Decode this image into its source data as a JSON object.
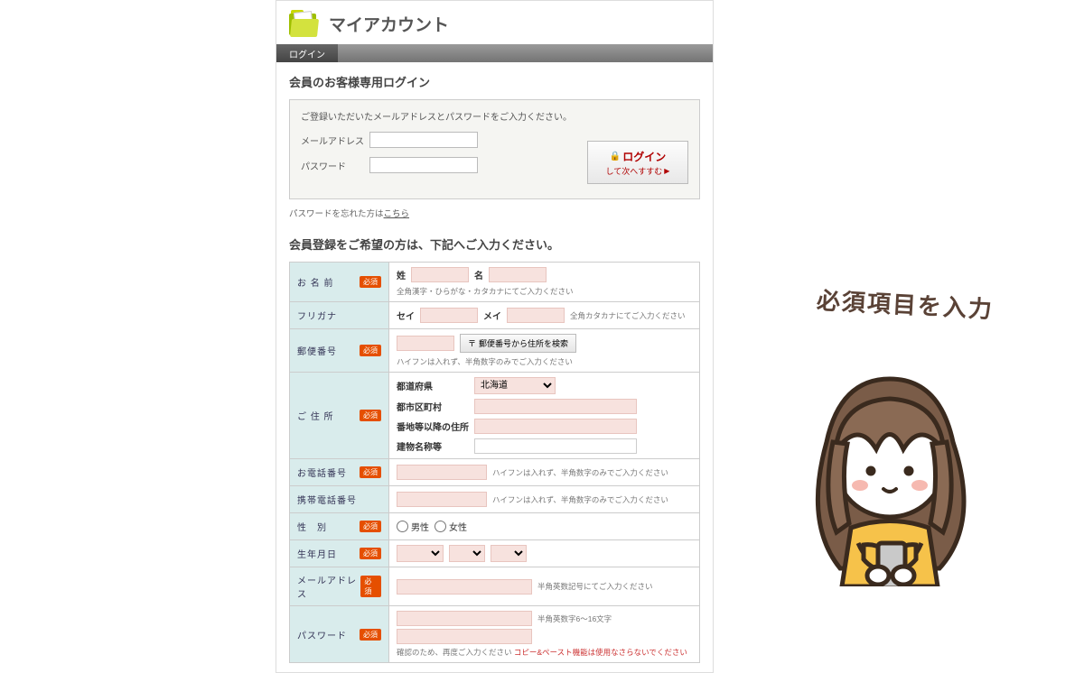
{
  "header": {
    "title": "マイアカウント"
  },
  "tabs": {
    "active": "ログイン"
  },
  "login": {
    "section_title": "会員のお客様専用ログイン",
    "note": "ご登録いただいたメールアドレスとパスワードをご入力ください。",
    "email_label": "メールアドレス",
    "password_label": "パスワード",
    "button_top": "ログイン",
    "button_sub": "して次へすすむ",
    "forgot_prefix": "パスワードを忘れた方は",
    "forgot_link": "こちら"
  },
  "register": {
    "section_title": "会員登録をご希望の方は、下記へご入力ください。",
    "required_badge": "必須",
    "rows": {
      "name": {
        "label": "お 名 前",
        "sei": "姓",
        "mei": "名",
        "hint": "全角漢字・ひらがな・カタカナにてご入力ください"
      },
      "furigana": {
        "label": "フリガナ",
        "sei": "セイ",
        "mei": "メイ",
        "hint": "全角カタカナにてご入力ください"
      },
      "zip": {
        "label": "郵便番号",
        "btn": "郵便番号から住所を検索",
        "hint": "ハイフンは入れず、半角数字のみでご入力ください"
      },
      "address": {
        "label": "ご 住 所",
        "pref": "都道府県",
        "pref_value": "北海道",
        "city": "都市区町村",
        "street": "番地等以降の住所",
        "building": "建物名称等"
      },
      "tel": {
        "label": "お電話番号",
        "hint": "ハイフンは入れず、半角数字のみでご入力ください"
      },
      "mobile": {
        "label": "携帯電話番号",
        "hint": "ハイフンは入れず、半角数字のみでご入力ください"
      },
      "gender": {
        "label": "性　別",
        "male": "男性",
        "female": "女性"
      },
      "birth": {
        "label": "生年月日"
      },
      "email": {
        "label": "メールアドレス",
        "hint": "半角英数記号にてご入力ください"
      },
      "password": {
        "label": "パスワード",
        "hint": "半角英数字6～16文字",
        "note_prefix": "確認のため、再度ご入力ください",
        "warn": "コピー&ペースト機能は使用なさらないでください"
      }
    }
  },
  "speech": "必須項目を入力"
}
